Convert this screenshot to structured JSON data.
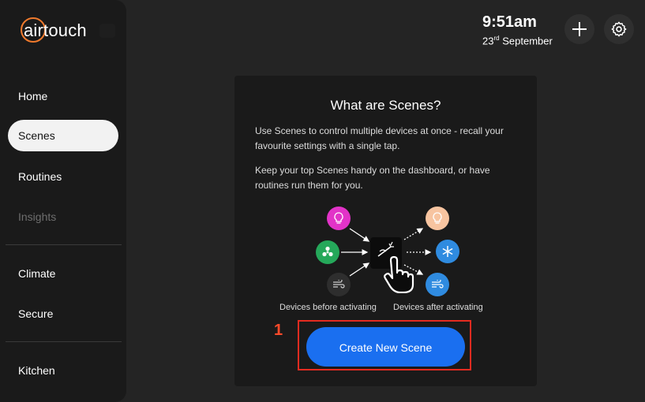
{
  "app": {
    "logo_text": "airtouch",
    "brand_color": "#f07a2c"
  },
  "sidebar": {
    "items": [
      {
        "label": "Home"
      },
      {
        "label": "Scenes",
        "active": true
      },
      {
        "label": "Routines"
      },
      {
        "label": "Insights",
        "disabled": true
      },
      {
        "label": "Climate"
      },
      {
        "label": "Secure"
      },
      {
        "label": "Kitchen"
      }
    ]
  },
  "header": {
    "time": "9:51am",
    "date_day": "23",
    "date_suffix": "rd",
    "date_month": "September",
    "add_icon": "plus-icon",
    "settings_icon": "gear-icon"
  },
  "card": {
    "title": "What are Scenes?",
    "paragraph1": "Use Scenes to control multiple devices at once - recall your favourite settings with a single tap.",
    "paragraph2": "Keep your top Scenes handy on the dashboard, or have routines run them for you.",
    "caption_before": "Devices before activating",
    "caption_after": "Devices after activating",
    "button_label": "Create New Scene",
    "button_color": "#1a6ff0"
  },
  "annotation": {
    "marker": "1",
    "color": "#e52b20"
  }
}
